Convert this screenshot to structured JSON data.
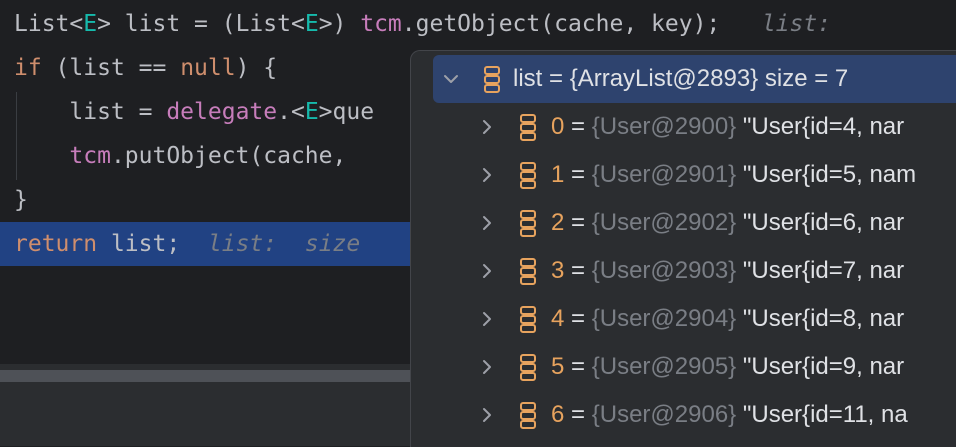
{
  "editor": {
    "line1": {
      "p1": "List<",
      "type1": "E",
      "p2": "> list = (List<",
      "type2": "E",
      "p3": ">) ",
      "field": "tcm",
      "p4": ".getObject(cache, key);",
      "hint": "list:"
    },
    "line2": {
      "kw1": "if",
      "p1": " (list == ",
      "kw2": "null",
      "p2": ") {"
    },
    "line3": {
      "p1": "    list = ",
      "field": "delegate",
      "p2": ".<",
      "type": "E",
      "p3": ">que"
    },
    "line4": {
      "p1": "    ",
      "field": "tcm",
      "p2": ".putObject(cache, "
    },
    "line5": {
      "p1": "}"
    },
    "line6": {
      "kw": "return",
      "p1": " list;",
      "hint1": "list:",
      "hint2": "size"
    }
  },
  "debugger_popup": {
    "root": {
      "name": "list",
      "eq": " = ",
      "value": "{ArrayList@2893}",
      "size": "size = 7"
    },
    "items": [
      {
        "index": "0",
        "eq": " = ",
        "ref": "{User@2900}",
        "text": "\"User{id=4, nar"
      },
      {
        "index": "1",
        "eq": " = ",
        "ref": "{User@2901}",
        "text": "\"User{id=5, nam"
      },
      {
        "index": "2",
        "eq": " = ",
        "ref": "{User@2902}",
        "text": "\"User{id=6, nar"
      },
      {
        "index": "3",
        "eq": " = ",
        "ref": "{User@2903}",
        "text": "\"User{id=7, nar"
      },
      {
        "index": "4",
        "eq": " = ",
        "ref": "{User@2904}",
        "text": "\"User{id=8, nar"
      },
      {
        "index": "5",
        "eq": " = ",
        "ref": "{User@2905}",
        "text": "\"User{id=9, nar"
      },
      {
        "index": "6",
        "eq": " = ",
        "ref": "{User@2906}",
        "text": "\"User{id=11, na"
      }
    ]
  },
  "icons": {
    "expand": "chevron-down-icon",
    "collapsed": "chevron-right-icon",
    "variable": "stack-icon"
  },
  "colors": {
    "keyword": "#cf8e6d",
    "type": "#16baac",
    "field": "#c77dbb",
    "selection": "#214283",
    "popup_bg": "#2b2d30",
    "index": "#e7a35e"
  }
}
